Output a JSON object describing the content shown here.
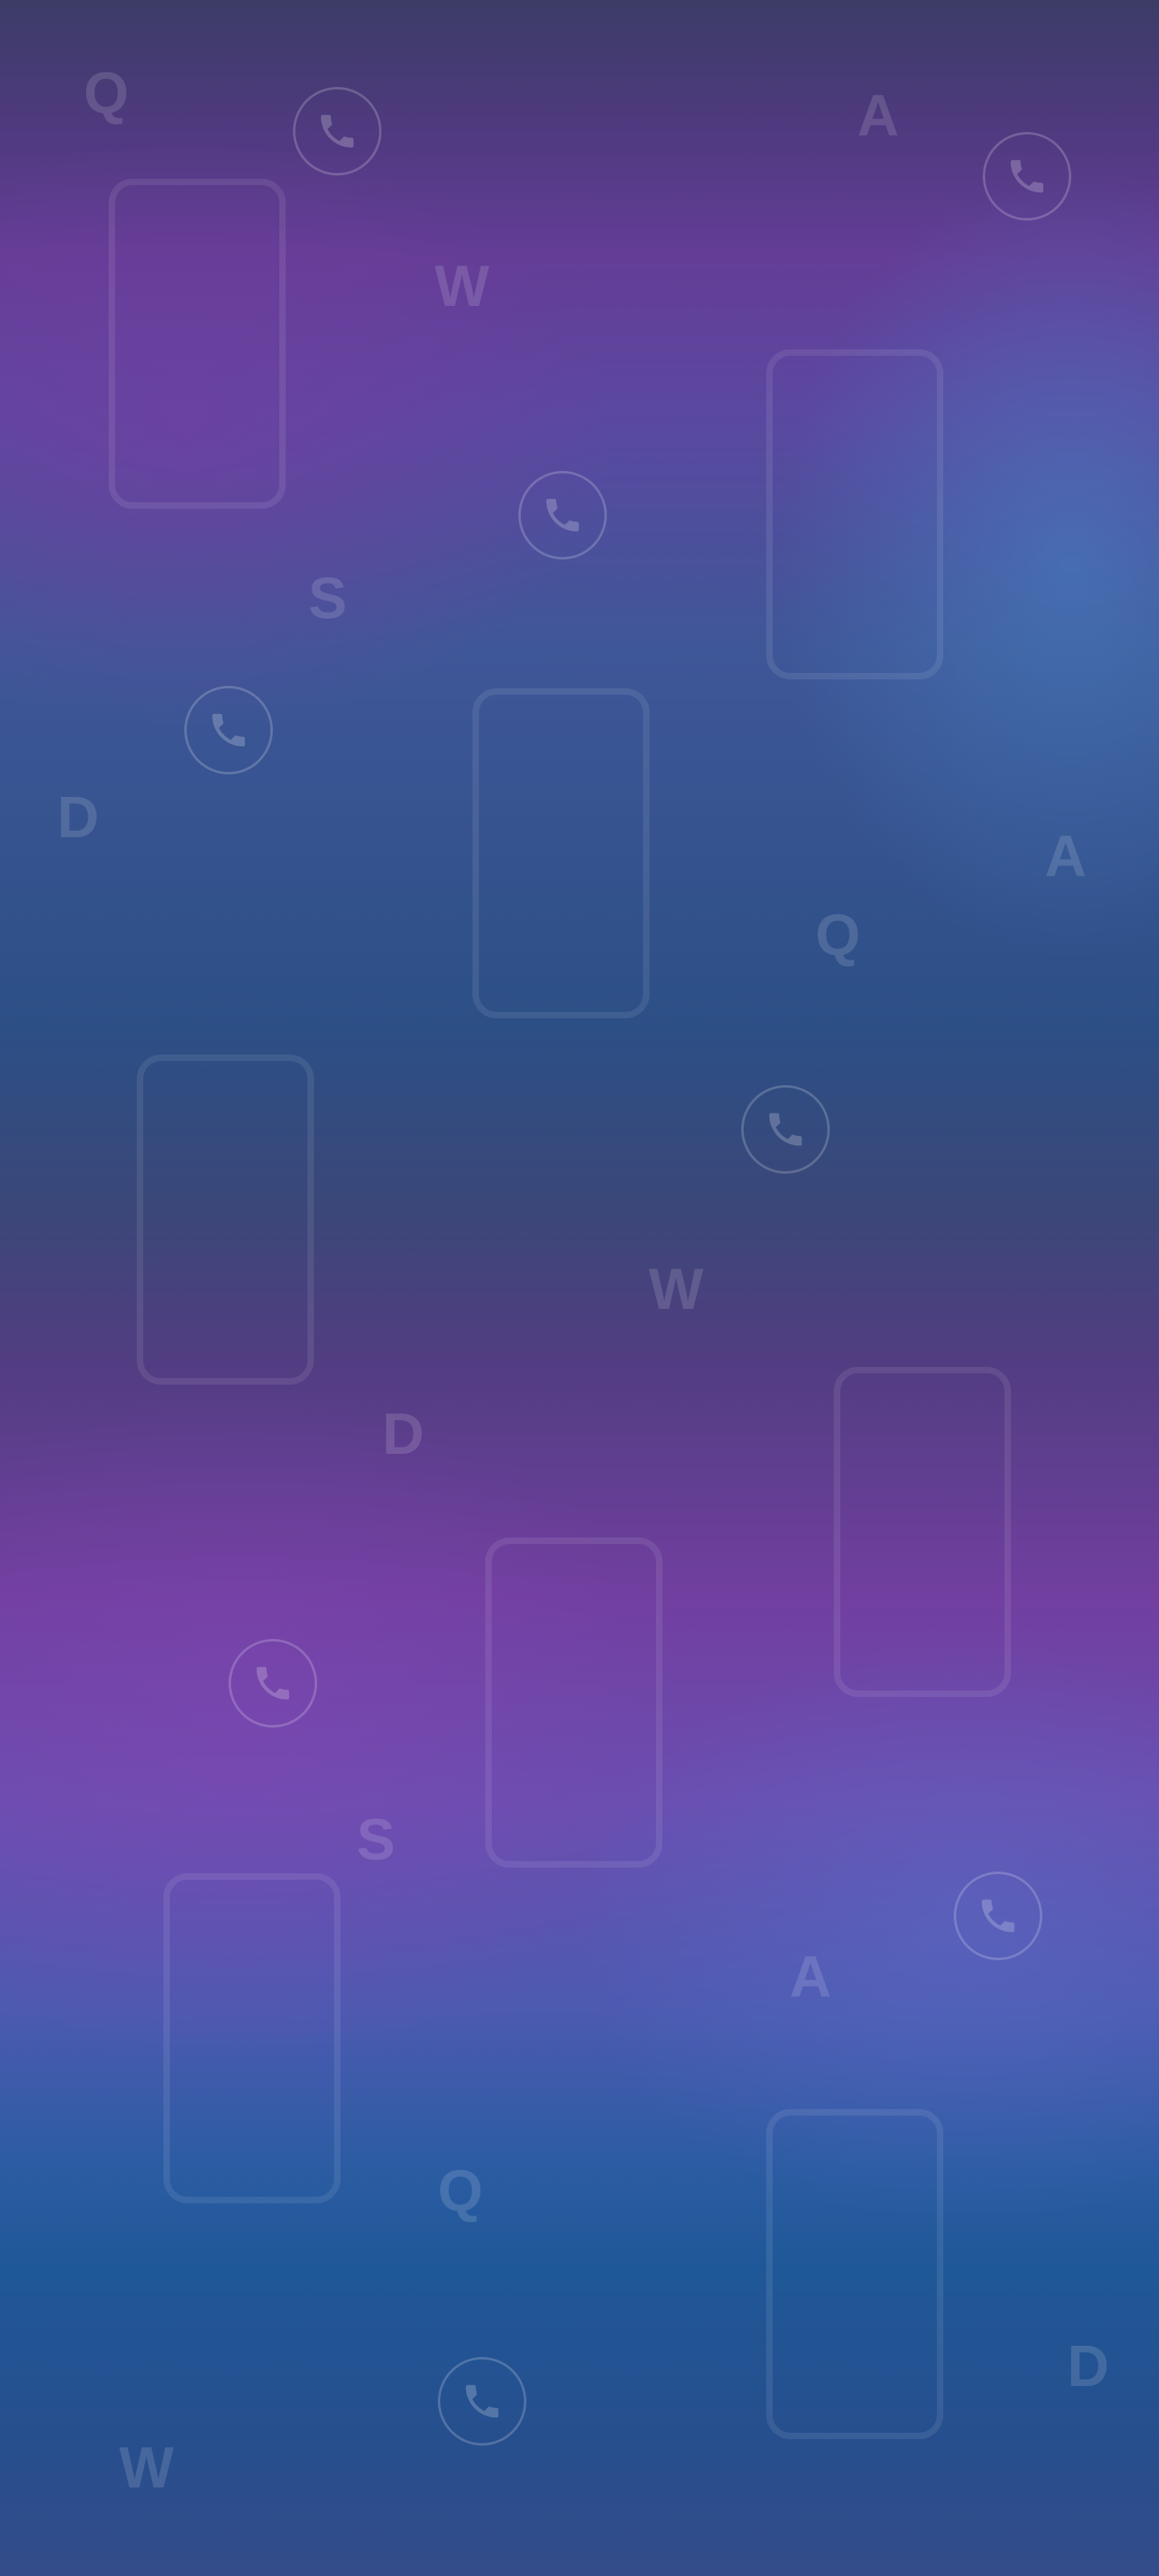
{
  "background": {
    "colors": [
      "#3c3c67",
      "#643d97",
      "#2c4f86",
      "#713fa0",
      "#1f5898",
      "#344c8a"
    ]
  },
  "letters": [
    {
      "name": "letter-q-1",
      "char": "Q"
    },
    {
      "name": "letter-a-1",
      "char": "A"
    },
    {
      "name": "letter-w-1",
      "char": "W"
    },
    {
      "name": "letter-s-1",
      "char": "S"
    },
    {
      "name": "letter-d-1",
      "char": "D"
    },
    {
      "name": "letter-a-2",
      "char": "A"
    },
    {
      "name": "letter-q-2",
      "char": "Q"
    },
    {
      "name": "letter-w-2",
      "char": "W"
    },
    {
      "name": "letter-d-2",
      "char": "D"
    },
    {
      "name": "letter-s-2",
      "char": "S"
    },
    {
      "name": "letter-a-3",
      "char": "A"
    },
    {
      "name": "letter-q-3",
      "char": "Q"
    },
    {
      "name": "letter-d-3",
      "char": "D"
    },
    {
      "name": "letter-w-3",
      "char": "W"
    }
  ],
  "icons": {
    "phone_frame": "phone-outline-icon",
    "call": "phone-call-icon"
  }
}
